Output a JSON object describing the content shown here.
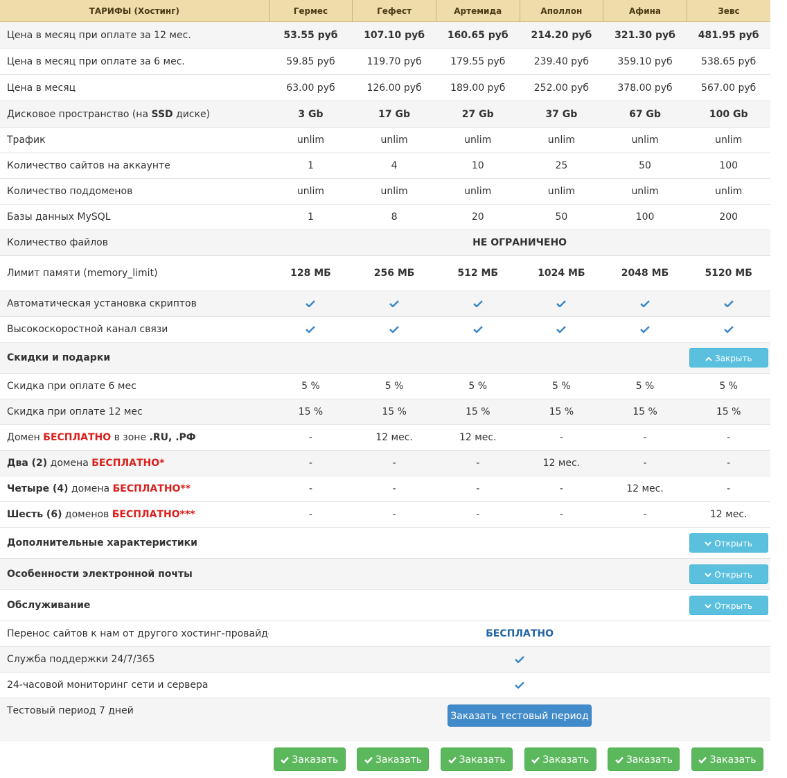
{
  "header": {
    "title": "ТАРИФЫ (Хостинг)",
    "plans": [
      "Гермес",
      "Гефест",
      "Артемида",
      "Аполлон",
      "Афина",
      "Зевс"
    ]
  },
  "rows": {
    "price12": {
      "label": "Цена в месяц при оплате за 12 мес.",
      "values": [
        "53.55 руб",
        "107.10 руб",
        "160.65 руб",
        "214.20 руб",
        "321.30 руб",
        "481.95 руб"
      ]
    },
    "price6": {
      "label": "Цена в месяц при оплате за 6 мес.",
      "values": [
        "59.85 руб",
        "119.70 руб",
        "179.55 руб",
        "239.40 руб",
        "359.10 руб",
        "538.65 руб"
      ]
    },
    "price1": {
      "label": "Цена в месяц",
      "values": [
        "63.00 руб",
        "126.00 руб",
        "189.00 руб",
        "252.00 руб",
        "378.00 руб",
        "567.00 руб"
      ]
    },
    "disk": {
      "label_pre": "Дисковое пространство (на ",
      "label_bold": "SSD",
      "label_post": " диске)",
      "values": [
        "3 Gb",
        "17 Gb",
        "27 Gb",
        "37 Gb",
        "67 Gb",
        "100 Gb"
      ]
    },
    "traffic": {
      "label": "Трафик",
      "values": [
        "unlim",
        "unlim",
        "unlim",
        "unlim",
        "unlim",
        "unlim"
      ]
    },
    "sites": {
      "label": "Количество сайтов на аккаунте",
      "values": [
        "1",
        "4",
        "10",
        "25",
        "50",
        "100"
      ]
    },
    "subdomains": {
      "label": "Количество поддоменов",
      "values": [
        "unlim",
        "unlim",
        "unlim",
        "unlim",
        "unlim",
        "unlim"
      ]
    },
    "mysql": {
      "label": "Базы данных MySQL",
      "values": [
        "1",
        "8",
        "20",
        "50",
        "100",
        "200"
      ]
    },
    "files": {
      "label": "Количество файлов",
      "value": "НЕ ОГРАНИЧЕНО"
    },
    "memory": {
      "label": "Лимит памяти (memory_limit)",
      "values": [
        "128 МБ",
        "256 МБ",
        "512 МБ",
        "1024 МБ",
        "2048 МБ",
        "5120 МБ"
      ]
    },
    "autoinstall": {
      "label": "Автоматическая установка скриптов"
    },
    "channel": {
      "label": "Высокоскоростной канал связи"
    }
  },
  "sections": {
    "discounts": {
      "label": "Скидки и подарки",
      "button": "Закрыть"
    },
    "extra": {
      "label": "Дополнительные характеристики",
      "button": "Открыть"
    },
    "email": {
      "label": "Особенности электронной почты",
      "button": "Открыть"
    },
    "service": {
      "label": "Обслуживание",
      "button": "Открыть"
    }
  },
  "discounts": {
    "d6": {
      "label": "Скидка при оплате 6 мес",
      "values": [
        "5 %",
        "5 %",
        "5 %",
        "5 %",
        "5 %",
        "5 %"
      ]
    },
    "d12": {
      "label": "Скидка при оплате 12 мес",
      "values": [
        "15 %",
        "15 %",
        "15 %",
        "15 %",
        "15 %",
        "15 %"
      ]
    },
    "dom1": {
      "pre": "Домен ",
      "red": "БЕСПЛАТНО",
      "mid": " в зоне ",
      "zones": ".RU, .РФ",
      "values": [
        "-",
        "12 мес.",
        "12 мес.",
        "-",
        "-",
        "-"
      ]
    },
    "dom2": {
      "bold": "Два (2)",
      "mid": " домена ",
      "red": "БЕСПЛАТНО*",
      "values": [
        "-",
        "-",
        "-",
        "12 мес.",
        "-",
        "-"
      ]
    },
    "dom4": {
      "bold": "Четыре (4)",
      "mid": " домена ",
      "red": "БЕСПЛАТНО**",
      "values": [
        "-",
        "-",
        "-",
        "-",
        "12 мес.",
        "-"
      ]
    },
    "dom6": {
      "bold": "Шесть (6)",
      "mid": " доменов ",
      "red": "БЕСПЛАТНО***",
      "values": [
        "-",
        "-",
        "-",
        "-",
        "-",
        "12 мес."
      ]
    }
  },
  "service": {
    "transfer": {
      "label": "Перенос сайтов к нам от другого хостинг-провайдера",
      "value": "БЕСПЛАТНО"
    },
    "support": {
      "label": "Служба поддержки 24/7/365"
    },
    "monitoring": {
      "label": "24-часовой мониторинг сети и сервера"
    },
    "trial": {
      "label": "Тестовый период 7 дней",
      "button": "Заказать тестовый период"
    }
  },
  "order_button": "Заказать",
  "colors": {
    "header_bg": "#eedcab",
    "info_button": "#5bc0de",
    "primary_button": "#428bca",
    "success_button": "#5cb85c",
    "check": "#3a87c8",
    "red": "#d9201c"
  }
}
